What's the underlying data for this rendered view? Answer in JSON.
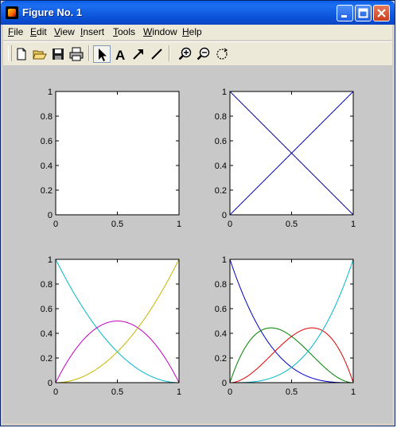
{
  "window": {
    "title": "Figure No. 1"
  },
  "menu": [
    {
      "label": "File",
      "accel": "F"
    },
    {
      "label": "Edit",
      "accel": "E"
    },
    {
      "label": "View",
      "accel": "V"
    },
    {
      "label": "Insert",
      "accel": "I"
    },
    {
      "label": "Tools",
      "accel": "T"
    },
    {
      "label": "Window",
      "accel": "W"
    },
    {
      "label": "Help",
      "accel": "H"
    }
  ],
  "toolbar": {
    "buttons": [
      {
        "icon": "new-figure-icon"
      },
      {
        "icon": "open-folder-icon"
      },
      {
        "icon": "save-icon"
      },
      {
        "icon": "print-icon"
      },
      {
        "icon": "select-arrow-icon"
      },
      {
        "icon": "insert-text-icon",
        "glyph": "A"
      },
      {
        "icon": "insert-arrow-icon"
      },
      {
        "icon": "insert-line-icon"
      },
      {
        "icon": "zoom-in-icon"
      },
      {
        "icon": "zoom-out-icon"
      },
      {
        "icon": "rotate-icon"
      }
    ]
  },
  "colors": {
    "figure_bg": "#c8c8c8",
    "axes_bg": "#ffffff"
  },
  "chart_data": [
    {
      "type": "line",
      "title": "",
      "xlabel": "",
      "ylabel": "",
      "xlim": [
        0,
        1
      ],
      "ylim": [
        0,
        1
      ],
      "xticks": [
        "0",
        "0.5",
        "1"
      ],
      "yticks": [
        "0",
        "0.2",
        "0.4",
        "0.6",
        "0.8",
        "1"
      ],
      "grid": false,
      "series": [
        {
          "color": "#000080",
          "degree": 0,
          "k": 0,
          "x": [
            0,
            1
          ],
          "y": [
            1,
            1
          ]
        }
      ]
    },
    {
      "type": "line",
      "title": "",
      "xlabel": "",
      "ylabel": "",
      "xlim": [
        0,
        1
      ],
      "ylim": [
        0,
        1
      ],
      "xticks": [
        "0",
        "0.5",
        "1"
      ],
      "yticks": [
        "0",
        "0.2",
        "0.4",
        "0.6",
        "0.8",
        "1"
      ],
      "grid": false,
      "series": [
        {
          "color": "#00008b",
          "degree": 1,
          "k": 0,
          "x": [
            0,
            0.5,
            1
          ],
          "y": [
            1,
            0.5,
            0
          ]
        },
        {
          "color": "#0000cc",
          "degree": 1,
          "k": 1,
          "x": [
            0,
            0.5,
            1
          ],
          "y": [
            0,
            0.5,
            1
          ]
        }
      ]
    },
    {
      "type": "line",
      "title": "",
      "xlabel": "",
      "ylabel": "",
      "xlim": [
        0,
        1
      ],
      "ylim": [
        0,
        1
      ],
      "xticks": [
        "0",
        "0.5",
        "1"
      ],
      "yticks": [
        "0",
        "0.2",
        "0.4",
        "0.6",
        "0.8",
        "1"
      ],
      "grid": false,
      "series": [
        {
          "color": "#00b8c8",
          "degree": 2,
          "k": 0,
          "x": [
            0,
            0.25,
            0.5,
            0.75,
            1
          ],
          "y": [
            1,
            0.5625,
            0.25,
            0.0625,
            0
          ]
        },
        {
          "color": "#c000c0",
          "degree": 2,
          "k": 1,
          "x": [
            0,
            0.25,
            0.5,
            0.75,
            1
          ],
          "y": [
            0,
            0.375,
            0.5,
            0.375,
            0
          ]
        },
        {
          "color": "#c8b400",
          "degree": 2,
          "k": 2,
          "x": [
            0,
            0.25,
            0.5,
            0.75,
            1
          ],
          "y": [
            0,
            0.0625,
            0.25,
            0.5625,
            1
          ]
        }
      ]
    },
    {
      "type": "line",
      "title": "",
      "xlabel": "",
      "ylabel": "",
      "xlim": [
        0,
        1
      ],
      "ylim": [
        0,
        1
      ],
      "xticks": [
        "0",
        "0.5",
        "1"
      ],
      "yticks": [
        "0",
        "0.2",
        "0.4",
        "0.6",
        "0.8",
        "1"
      ],
      "grid": false,
      "series": [
        {
          "color": "#0000c8",
          "degree": 3,
          "k": 0,
          "x": [
            0,
            0.333,
            0.5,
            0.667,
            1
          ],
          "y": [
            1,
            0.296,
            0.125,
            0.037,
            0
          ]
        },
        {
          "color": "#008000",
          "degree": 3,
          "k": 1,
          "x": [
            0,
            0.333,
            0.5,
            0.667,
            1
          ],
          "y": [
            0,
            0.444,
            0.375,
            0.222,
            0
          ]
        },
        {
          "color": "#e00000",
          "degree": 3,
          "k": 2,
          "x": [
            0,
            0.333,
            0.5,
            0.667,
            1
          ],
          "y": [
            0,
            0.222,
            0.375,
            0.444,
            0
          ]
        },
        {
          "color": "#00b8c8",
          "degree": 3,
          "k": 3,
          "x": [
            0,
            0.333,
            0.5,
            0.667,
            1
          ],
          "y": [
            0,
            0.037,
            0.125,
            0.296,
            1
          ]
        }
      ]
    }
  ]
}
